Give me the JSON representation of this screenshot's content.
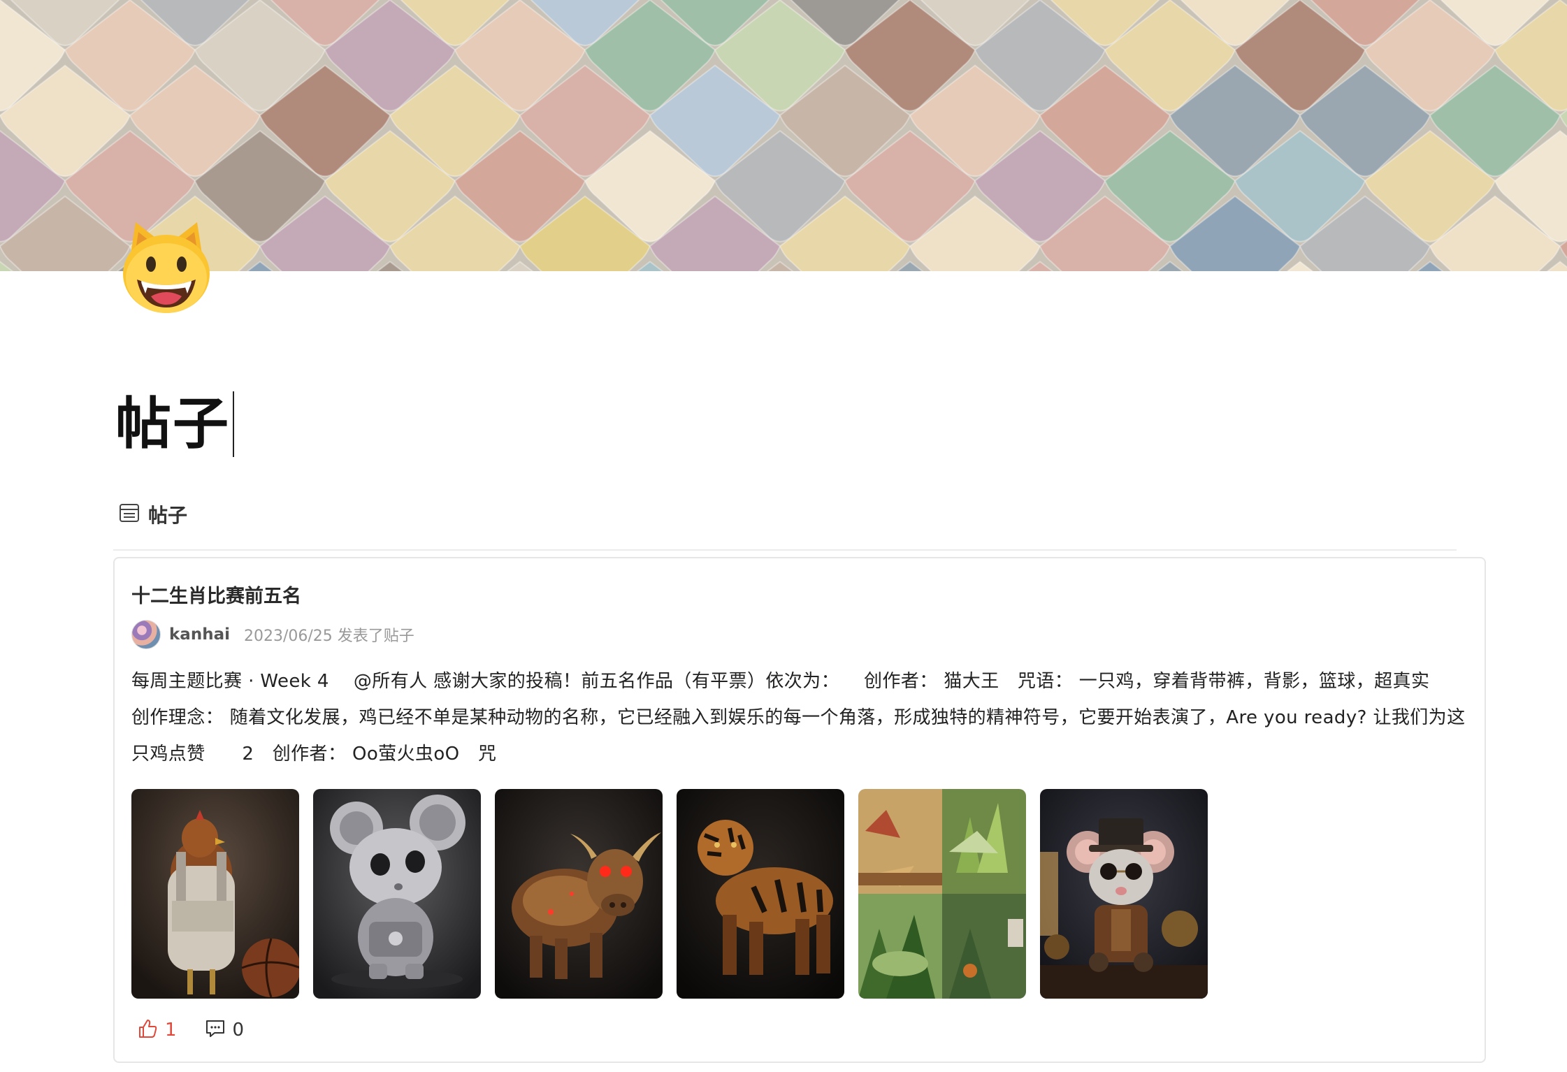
{
  "page": {
    "icon": "grinning-cat-emoji",
    "title": "帖子"
  },
  "view_tab": {
    "icon": "list-view-icon",
    "label": "帖子"
  },
  "post": {
    "title": "十二生肖比赛前五名",
    "author": "kanhai",
    "date_text": "2023/06/25 发表了贴子",
    "body": "每周主题比赛 · Week 4 　@所有人 感谢大家的投稿！前五名作品（有平票）依次为： 　创作者： 猫大王　咒语： 一只鸡，穿着背带裤，背影，篮球，超真实　创作理念： 随着文化发展，鸡已经不单是某种动物的名称，它已经融入到娱乐的每一个角落，形成独特的精神符号，它要开始表演了，Are you ready? 让我们为这只鸡点赞　　2　创作者： Oo萤火虫oO　咒",
    "images": [
      {
        "subject": "chicken-in-overalls-with-basketball"
      },
      {
        "subject": "silver-robot-mouse"
      },
      {
        "subject": "bronze-mechanical-bull"
      },
      {
        "subject": "mechanical-tiger"
      },
      {
        "subject": "paper-craft-collage"
      },
      {
        "subject": "steampunk-mouse"
      }
    ],
    "like_count": "1",
    "comment_count": "0"
  },
  "colors": {
    "like": "#e0483a",
    "border": "#e6e6e6"
  }
}
